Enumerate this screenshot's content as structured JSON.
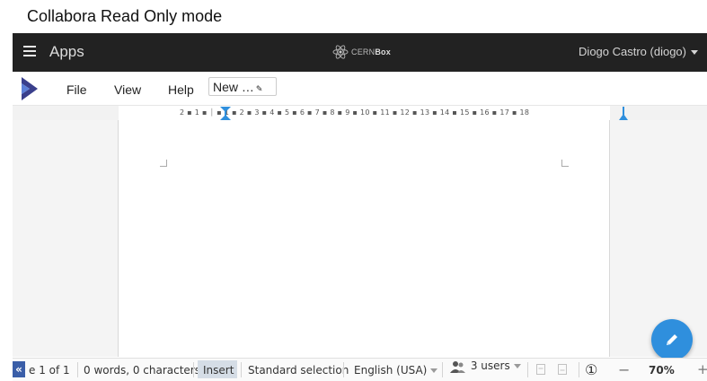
{
  "caption": "Collabora Read Only mode",
  "topbar": {
    "apps_label": "Apps",
    "brand_prefix": "CERN",
    "brand_suffix": "Box",
    "user_label": "Diogo Castro (diogo)"
  },
  "menubar": {
    "file": "File",
    "view": "View",
    "help": "Help",
    "document_name": "New …"
  },
  "ruler": {
    "ticks": "2 ▪ 1 ▪ ⏐ ▪ 1 ▪ 2 ▪ 3 ▪ 4 ▪ 5 ▪ 6 ▪ 7 ▪ 8 ▪ 9 ▪ 10 ▪ 11 ▪ 12 ▪ 13 ▪ 14 ▪ 15 ▪ 16 ▪ 17 ▪ 18"
  },
  "statusbar": {
    "collapse_glyph": "«",
    "page_info": "e 1 of 1",
    "word_count": "0 words, 0 characters",
    "mode": "Insert",
    "selection_mode": "Standard selection",
    "language": "English (USA)",
    "users": "3 users",
    "zoom_reset_glyph": "①",
    "zoom_out_glyph": "−",
    "zoom_level": "70%",
    "zoom_in_glyph": "+"
  },
  "colors": {
    "topbar_bg": "#222222",
    "fab_bg": "#2f8fdd",
    "logo_primary": "#3a3f8c",
    "logo_secondary": "#5c7fd8"
  },
  "icons": {
    "menu": "hamburger-icon",
    "brand": "atom-icon",
    "app_logo": "chevron-logo-icon",
    "edit": "pencil-icon",
    "users": "users-icon",
    "collapse": "double-chevron-left-icon"
  }
}
